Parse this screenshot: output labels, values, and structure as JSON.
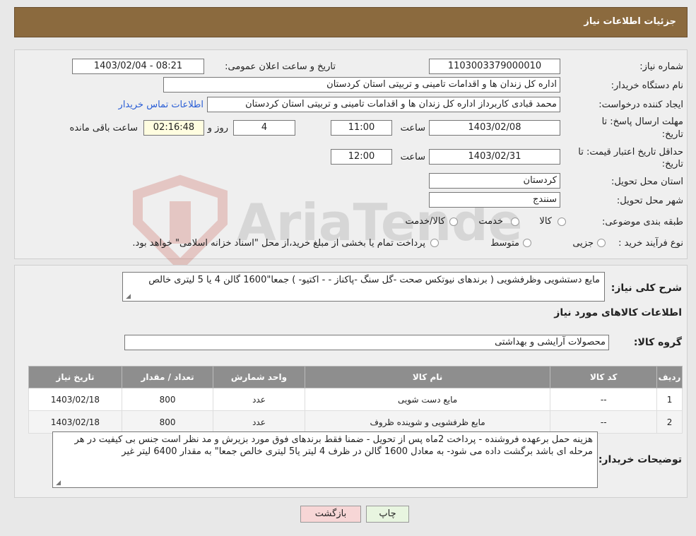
{
  "header": {
    "title": "جزئیات اطلاعات نیاز"
  },
  "fields": {
    "need_number_label": "شماره نیاز:",
    "need_number": "1103003379000010",
    "announce_label": "تاریخ و ساعت اعلان عمومی:",
    "announce_value": "1403/02/04 - 08:21",
    "buyer_org_label": "نام دستگاه خریدار:",
    "buyer_org": "اداره کل زندان ها و اقدامات تامینی و تربیتی استان کردستان",
    "creator_label": "ایجاد کننده درخواست:",
    "creator": "محمد  قبادی کاربرداز اداره کل زندان ها و اقدامات تامینی و تربیتی استان کردستان",
    "contact_link": "اطلاعات تماس خریدار",
    "deadline_label": "مهلت ارسال پاسخ: تا",
    "date_label": "تاریخ:",
    "deadline_date": "1403/02/08",
    "time_label": "ساعت",
    "deadline_time": "11:00",
    "days_value": "4",
    "days_label": "روز و",
    "remaining_time": "02:16:48",
    "remaining_label": "ساعت باقی مانده",
    "validity_label": "حداقل تاریخ اعتبار قیمت: تا",
    "validity_date": "1403/02/31",
    "validity_time": "12:00",
    "province_label": "استان محل تحویل:",
    "province": "کردستان",
    "city_label": "شهر محل تحویل:",
    "city": "سنندج",
    "category_label": "طبقه بندی موضوعی:",
    "category_options": [
      "کالا",
      "خدمت",
      "کالا/خدمت"
    ],
    "process_label": "نوع فرآیند خرید :",
    "process_options": [
      "جزیی",
      "متوسط"
    ],
    "process_note": "پرداخت تمام یا بخشی از مبلغ خرید،از محل \"اسناد خزانه اسلامی\" خواهد بود."
  },
  "description": {
    "label": "شرح کلی نیاز:",
    "text": "مایع دستشویی  وظرفشویی  ( برندهای  نیوتکس  صحت  -گل سنگ -پاکناز -  - اکتیو- )   جمعا\"1600 گالن 4 یا 5 لیتری خالص"
  },
  "goods": {
    "section_title": "اطلاعات کالاهای مورد نیاز",
    "group_label": "گروه کالا:",
    "group_value": "محصولات آرایشی و بهداشتی",
    "columns": [
      "ردیف",
      "کد کالا",
      "نام کالا",
      "واحد شمارش",
      "تعداد / مقدار",
      "تاریخ نیاز"
    ],
    "rows": [
      [
        "1",
        "--",
        "مایع دست شویی",
        "عدد",
        "800",
        "1403/02/18"
      ],
      [
        "2",
        "--",
        "مایع ظرفشویی و شوینده ظروف",
        "عدد",
        "800",
        "1403/02/18"
      ]
    ]
  },
  "buyer_notes": {
    "label": "توضیحات خریدار:",
    "text": "هزینه  حمل برعهده فروشنده - پرداخت 2ماه پس از تحویل - ضمنا فقط برندهای فوق  مورد بزیرش و مد  نظر است جنس بی کیفیت  در هر مرحله ای باشد برگشت داده می شود-  به  معادل 1600 گالن  در ظرف 4 لیتر یا5 لیتری خالص  جمعا\" به مقدار 6400 لیتر غیر"
  },
  "buttons": {
    "print": "چاپ",
    "back": "بازگشت"
  },
  "watermark": "AriaTender.neT",
  "colors": {
    "header": "#8b6a3e",
    "back_button": "#f7d6d6",
    "print_button": "#e8f5e0",
    "link": "#2a5ed6"
  }
}
